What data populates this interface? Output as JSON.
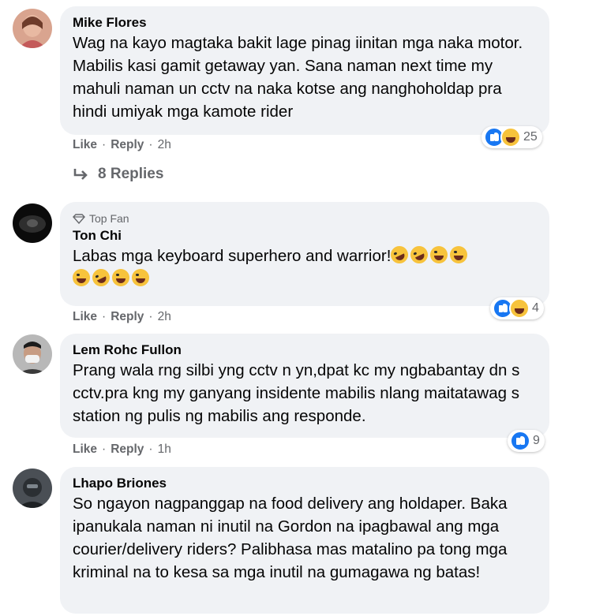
{
  "comments": [
    {
      "name": "Mike Flores",
      "text": "Wag na kayo magtaka bakit lage pinag iinitan mga naka motor. Mabilis kasi gamit getaway yan. Sana naman next time my mahuli naman un cctv na naka kotse ang nanghoholdap pra hindi umiyak mga kamote rider",
      "like": "Like",
      "reply": "Reply",
      "time": "2h",
      "reaction_count": "25"
    },
    {
      "badge": "Top Fan",
      "name": "Ton Chi",
      "text": "Labas mga keyboard superhero and warrior!",
      "like": "Like",
      "reply": "Reply",
      "time": "2h",
      "reaction_count": "4"
    },
    {
      "name": "Lem Rohc Fullon",
      "text": "Prang wala rng silbi yng cctv n yn,dpat kc my ngbabantay dn s cctv.pra kng my ganyang insidente mabilis nlang maitatawag s station ng pulis ng mabilis ang responde.",
      "like": "Like",
      "reply": "Reply",
      "time": "1h",
      "reaction_count": "9"
    },
    {
      "name": "Lhapo Briones",
      "text": "So ngayon nagpanggap na food delivery ang holdaper. Baka ipanukala naman ni inutil na Gordon na ipagbawal ang mga courier/delivery riders? Palibhasa mas matalino pa tong mga kriminal na to kesa sa mga inutil na gumagawa ng batas!"
    }
  ],
  "replies_label": "8 Replies",
  "icons": [
    "reply-arrow-icon",
    "diamond-icon",
    "like-reaction-icon",
    "haha-reaction-icon",
    "laughing-emoji-icon",
    "rofl-emoji-icon"
  ],
  "colors": {
    "bubble": "#f0f2f5",
    "meta": "#65676b",
    "like_blue": "#1877f2",
    "emoji_yellow": "#f7c33c"
  }
}
